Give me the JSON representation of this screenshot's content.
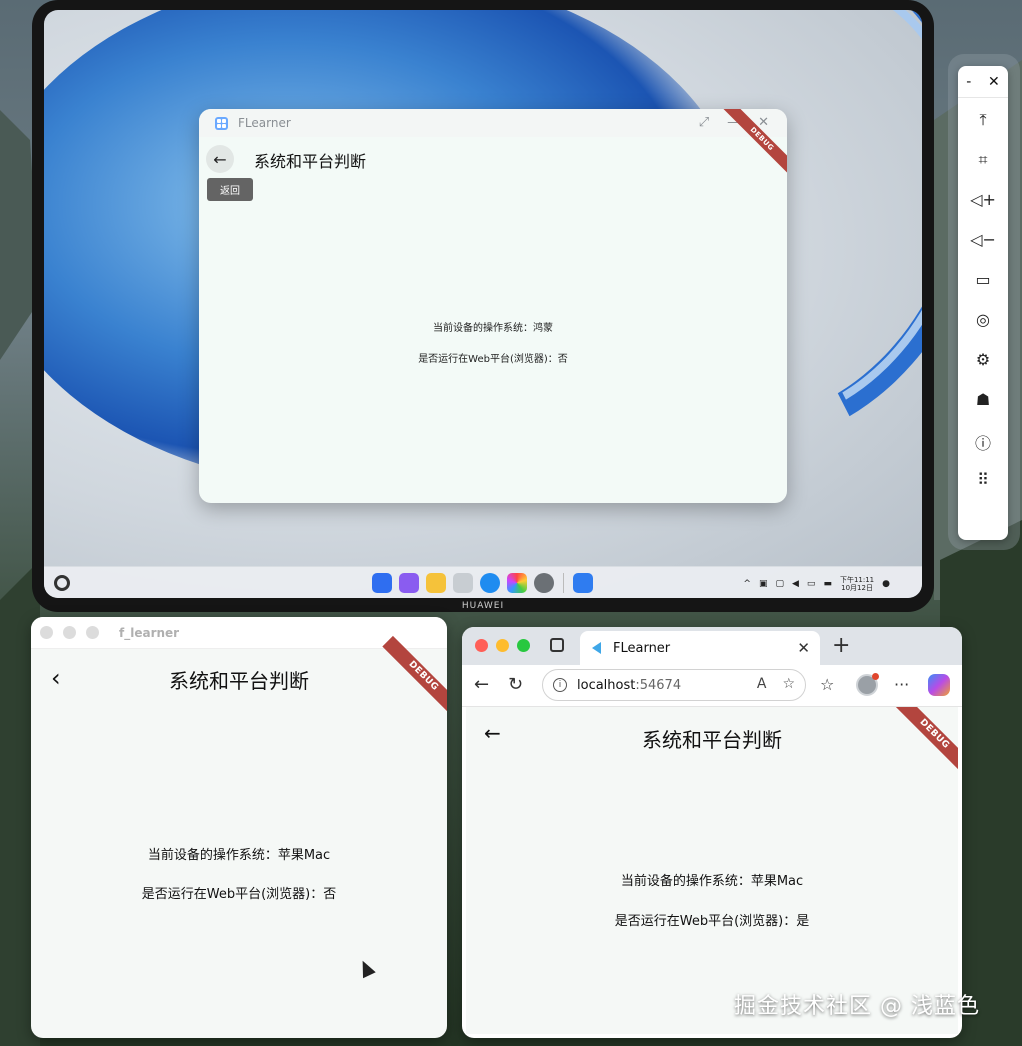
{
  "colors": {
    "debug_ribbon": "#b3453e",
    "app_background": "#f3faf7",
    "mac_light_red": "#ff5f57",
    "mac_light_yellow": "#febc2e",
    "mac_light_green": "#28c840"
  },
  "tablet": {
    "brand": "HUAWEI",
    "app_window": {
      "title": "FLearner",
      "controls": [
        "⤢",
        "—",
        "✕"
      ],
      "debug_label": "DEBUG",
      "heading": "系统和平台判断",
      "back_tooltip": "返回",
      "os_line": "当前设备的操作系统：鸿蒙",
      "web_line": "是否运行在Web平台(浏览器)：否"
    },
    "taskbar": {
      "clock_time": "下午11:11",
      "clock_date": "10月12日"
    }
  },
  "side_panel": {
    "controls": [
      "-",
      "✕"
    ],
    "tools": [
      "pin-top-icon",
      "crop-icon",
      "volume-up-icon",
      "volume-down-icon",
      "label-icon",
      "globe-icon",
      "settings-icon",
      "bug-icon",
      "info-icon",
      "keyboard-icon"
    ]
  },
  "mac_window": {
    "title": "f_learner",
    "debug_label": "DEBUG",
    "heading": "系统和平台判断",
    "os_line": "当前设备的操作系统：苹果Mac",
    "web_line": "是否运行在Web平台(浏览器)：否"
  },
  "browser": {
    "tab_title": "FLearner",
    "address_host": "localhost",
    "address_port": ":54674",
    "debug_label": "DEBUG",
    "heading": "系统和平台判断",
    "os_line": "当前设备的操作系统：苹果Mac",
    "web_line": "是否运行在Web平台(浏览器)：是"
  },
  "watermark": "掘金技术社区 @ 浅蓝色"
}
